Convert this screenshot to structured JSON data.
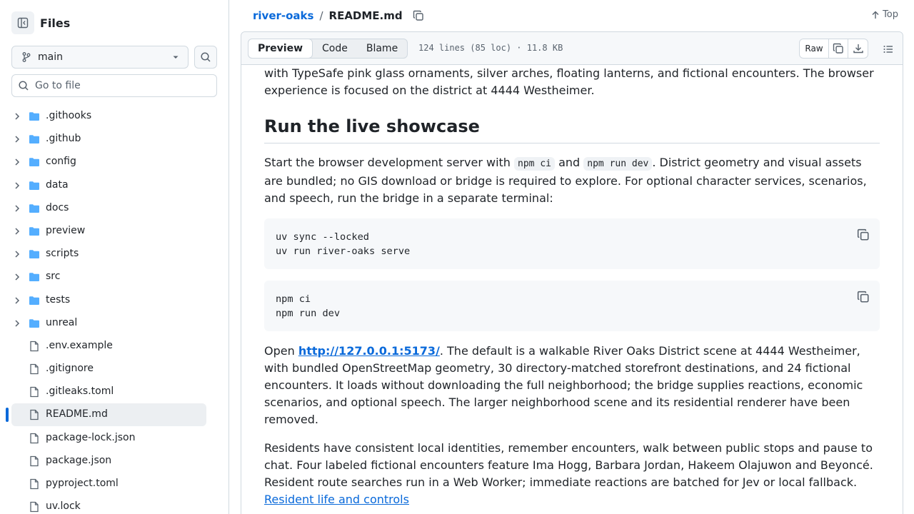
{
  "sidebar": {
    "title": "Files",
    "branch": "main",
    "goto_placeholder": "Go to file",
    "items": [
      {
        "name": ".githooks",
        "type": "dir"
      },
      {
        "name": ".github",
        "type": "dir"
      },
      {
        "name": "config",
        "type": "dir"
      },
      {
        "name": "data",
        "type": "dir"
      },
      {
        "name": "docs",
        "type": "dir"
      },
      {
        "name": "preview",
        "type": "dir"
      },
      {
        "name": "scripts",
        "type": "dir"
      },
      {
        "name": "src",
        "type": "dir"
      },
      {
        "name": "tests",
        "type": "dir"
      },
      {
        "name": "unreal",
        "type": "dir"
      },
      {
        "name": ".env.example",
        "type": "file"
      },
      {
        "name": ".gitignore",
        "type": "file"
      },
      {
        "name": ".gitleaks.toml",
        "type": "file"
      },
      {
        "name": "README.md",
        "type": "file",
        "active": true
      },
      {
        "name": "package-lock.json",
        "type": "file"
      },
      {
        "name": "package.json",
        "type": "file"
      },
      {
        "name": "pyproject.toml",
        "type": "file"
      },
      {
        "name": "uv.lock",
        "type": "file"
      }
    ]
  },
  "header": {
    "repo": "river-oaks",
    "separator": "/",
    "file": "README.md",
    "top_label": "Top"
  },
  "file_header": {
    "tabs": [
      "Preview",
      "Code",
      "Blame"
    ],
    "selected_tab": "Preview",
    "meta": "124 lines (85 loc) · 11.8 KB",
    "raw_label": "Raw"
  },
  "content": {
    "intro_line1": "with TypeSafe pink glass ornaments, silver arches, floating lanterns, and fictional encounters. The browser",
    "intro_line2": "experience is focused on the district at 4444 Westheimer.",
    "heading": "Run the live showcase",
    "p1_a": "Start the browser development server with ",
    "p1_code1": "npm ci",
    "p1_b": " and ",
    "p1_code2": "npm run dev",
    "p1_c": ". District geometry and visual assets are bundled; no GIS download or bridge is required to explore. For optional character services, scenarios, and speech, run the bridge in a separate terminal:",
    "code1": [
      "uv sync --locked",
      "uv run river-oaks serve"
    ],
    "code2": [
      "npm ci",
      "npm run dev"
    ],
    "p2_a": "Open ",
    "p2_link": "http://127.0.0.1:5173/",
    "p2_b": ". The default is a walkable River Oaks District scene at 4444 Westheimer, with bundled OpenStreetMap geometry, 30 directory-matched storefront destinations, and 24 fictional encounters. It loads without downloading the full neighborhood; the bridge supplies reactions, economic scenarios, and optional speech. The larger neighborhood scene and its residential renderer have been removed.",
    "p3": "Residents have consistent local identities, remember encounters, walk between public stops and pause to chat. Four labeled fictional encounters feature Ima Hogg, Barbara Jordan, Hakeem Olajuwon and Beyoncé. Resident route searches run in a Web Worker; immediate reactions are batched for Jev or local fallback.",
    "p3_link": "Resident life and controls"
  },
  "colors": {
    "accent": "#0969da",
    "folder": "#54aeff",
    "border": "#d1d9e0"
  }
}
